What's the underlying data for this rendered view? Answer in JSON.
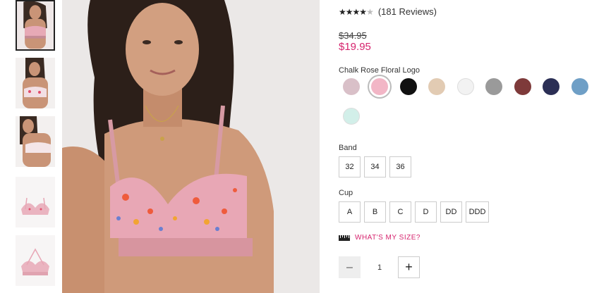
{
  "product": {
    "rating": 4,
    "max_rating": 5,
    "reviews_label": "(181 Reviews)",
    "old_price": "$34.95",
    "price": "$19.95",
    "selected_color": "Chalk Rose Floral Logo"
  },
  "colors": [
    "#d9c0c8",
    "#f2b6c6",
    "#111111",
    "#e2cbb3",
    "#f2f2f2",
    "#9a9a9a",
    "#7e3a3a",
    "#2b2f55",
    "#6f9fc6",
    "#d2efe9"
  ],
  "band": {
    "label": "Band",
    "options": [
      "32",
      "34",
      "36"
    ]
  },
  "cup": {
    "label": "Cup",
    "options": [
      "A",
      "B",
      "C",
      "D",
      "DD",
      "DDD"
    ]
  },
  "size_guide": {
    "label": "WHAT'S MY SIZE?"
  },
  "quantity": {
    "minus": "–",
    "value": "1",
    "plus": "+"
  }
}
